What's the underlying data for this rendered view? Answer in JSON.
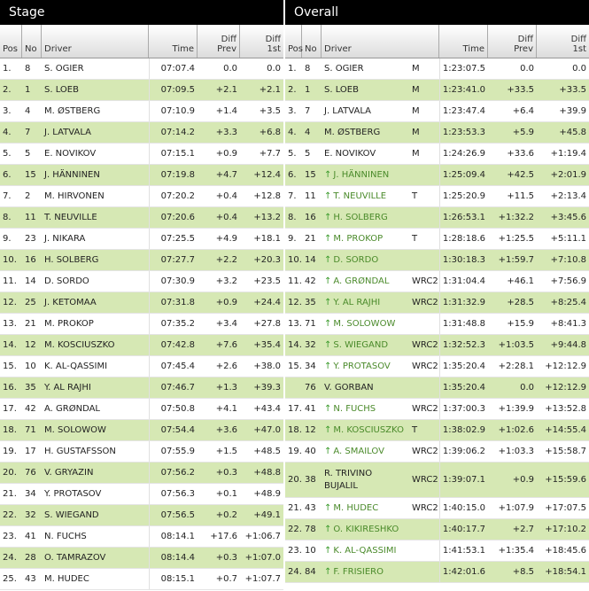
{
  "stage": {
    "title": "Stage",
    "headers": {
      "pos": "Pos",
      "no": "No",
      "driver": "Driver",
      "time": "Time",
      "diff_prev": "Diff\nPrev",
      "diff_1st": "Diff\n1st"
    },
    "rows": [
      {
        "pos": "1.",
        "no": "8",
        "driver": "S. OGIER",
        "time": "07:07.4",
        "dp": "0.0",
        "d1": "0.0"
      },
      {
        "pos": "2.",
        "no": "1",
        "driver": "S. LOEB",
        "time": "07:09.5",
        "dp": "+2.1",
        "d1": "+2.1"
      },
      {
        "pos": "3.",
        "no": "4",
        "driver": "M. ØSTBERG",
        "time": "07:10.9",
        "dp": "+1.4",
        "d1": "+3.5"
      },
      {
        "pos": "4.",
        "no": "7",
        "driver": "J. LATVALA",
        "time": "07:14.2",
        "dp": "+3.3",
        "d1": "+6.8"
      },
      {
        "pos": "5.",
        "no": "5",
        "driver": "E. NOVIKOV",
        "time": "07:15.1",
        "dp": "+0.9",
        "d1": "+7.7"
      },
      {
        "pos": "6.",
        "no": "15",
        "driver": "J. HÄNNINEN",
        "time": "07:19.8",
        "dp": "+4.7",
        "d1": "+12.4"
      },
      {
        "pos": "7.",
        "no": "2",
        "driver": "M. HIRVONEN",
        "time": "07:20.2",
        "dp": "+0.4",
        "d1": "+12.8"
      },
      {
        "pos": "8.",
        "no": "11",
        "driver": "T. NEUVILLE",
        "time": "07:20.6",
        "dp": "+0.4",
        "d1": "+13.2"
      },
      {
        "pos": "9.",
        "no": "23",
        "driver": "J. NIKARA",
        "time": "07:25.5",
        "dp": "+4.9",
        "d1": "+18.1"
      },
      {
        "pos": "10.",
        "no": "16",
        "driver": "H. SOLBERG",
        "time": "07:27.7",
        "dp": "+2.2",
        "d1": "+20.3"
      },
      {
        "pos": "11.",
        "no": "14",
        "driver": "D. SORDO",
        "time": "07:30.9",
        "dp": "+3.2",
        "d1": "+23.5"
      },
      {
        "pos": "12.",
        "no": "25",
        "driver": "J. KETOMAA",
        "time": "07:31.8",
        "dp": "+0.9",
        "d1": "+24.4"
      },
      {
        "pos": "13.",
        "no": "21",
        "driver": "M. PROKOP",
        "time": "07:35.2",
        "dp": "+3.4",
        "d1": "+27.8"
      },
      {
        "pos": "14.",
        "no": "12",
        "driver": "M. KOSCIUSZKO",
        "time": "07:42.8",
        "dp": "+7.6",
        "d1": "+35.4"
      },
      {
        "pos": "15.",
        "no": "10",
        "driver": "K. AL-QASSIMI",
        "time": "07:45.4",
        "dp": "+2.6",
        "d1": "+38.0"
      },
      {
        "pos": "16.",
        "no": "35",
        "driver": "Y. AL RAJHI",
        "time": "07:46.7",
        "dp": "+1.3",
        "d1": "+39.3"
      },
      {
        "pos": "17.",
        "no": "42",
        "driver": "A. GRØNDAL",
        "time": "07:50.8",
        "dp": "+4.1",
        "d1": "+43.4"
      },
      {
        "pos": "18.",
        "no": "71",
        "driver": "M. SOLOWOW",
        "time": "07:54.4",
        "dp": "+3.6",
        "d1": "+47.0"
      },
      {
        "pos": "19.",
        "no": "17",
        "driver": "H. GUSTAFSSON",
        "time": "07:55.9",
        "dp": "+1.5",
        "d1": "+48.5"
      },
      {
        "pos": "20.",
        "no": "76",
        "driver": "V. GRYAZIN",
        "time": "07:56.2",
        "dp": "+0.3",
        "d1": "+48.8"
      },
      {
        "pos": "21.",
        "no": "34",
        "driver": "Y. PROTASOV",
        "time": "07:56.3",
        "dp": "+0.1",
        "d1": "+48.9"
      },
      {
        "pos": "22.",
        "no": "32",
        "driver": "S. WIEGAND",
        "time": "07:56.5",
        "dp": "+0.2",
        "d1": "+49.1"
      },
      {
        "pos": "23.",
        "no": "41",
        "driver": "N. FUCHS",
        "time": "08:14.1",
        "dp": "+17.6",
        "d1": "+1:06.7"
      },
      {
        "pos": "24.",
        "no": "28",
        "driver": "O. TAMRAZOV",
        "time": "08:14.4",
        "dp": "+0.3",
        "d1": "+1:07.0"
      },
      {
        "pos": "25.",
        "no": "43",
        "driver": "M. HUDEC",
        "time": "08:15.1",
        "dp": "+0.7",
        "d1": "+1:07.7"
      }
    ]
  },
  "overall": {
    "title": "Overall",
    "headers": {
      "pos": "Pos",
      "no": "No",
      "driver": "Driver",
      "time": "Time",
      "diff_prev": "Diff\nPrev",
      "diff_1st": "Diff\n1st"
    },
    "rows": [
      {
        "pos": "1.",
        "no": "8",
        "up": false,
        "driver": "S. OGIER",
        "cls": "M",
        "time": "1:23:07.5",
        "dp": "0.0",
        "d1": "0.0"
      },
      {
        "pos": "2.",
        "no": "1",
        "up": false,
        "driver": "S. LOEB",
        "cls": "M",
        "time": "1:23:41.0",
        "dp": "+33.5",
        "d1": "+33.5"
      },
      {
        "pos": "3.",
        "no": "7",
        "up": false,
        "driver": "J. LATVALA",
        "cls": "M",
        "time": "1:23:47.4",
        "dp": "+6.4",
        "d1": "+39.9"
      },
      {
        "pos": "4.",
        "no": "4",
        "up": false,
        "driver": "M. ØSTBERG",
        "cls": "M",
        "time": "1:23:53.3",
        "dp": "+5.9",
        "d1": "+45.8"
      },
      {
        "pos": "5.",
        "no": "5",
        "up": false,
        "driver": "E. NOVIKOV",
        "cls": "M",
        "time": "1:24:26.9",
        "dp": "+33.6",
        "d1": "+1:19.4"
      },
      {
        "pos": "6.",
        "no": "15",
        "up": true,
        "driver": "J. HÄNNINEN",
        "cls": "",
        "time": "1:25:09.4",
        "dp": "+42.5",
        "d1": "+2:01.9"
      },
      {
        "pos": "7.",
        "no": "11",
        "up": true,
        "driver": "T. NEUVILLE",
        "cls": "T",
        "time": "1:25:20.9",
        "dp": "+11.5",
        "d1": "+2:13.4"
      },
      {
        "pos": "8.",
        "no": "16",
        "up": true,
        "driver": "H. SOLBERG",
        "cls": "",
        "time": "1:26:53.1",
        "dp": "+1:32.2",
        "d1": "+3:45.6"
      },
      {
        "pos": "9.",
        "no": "21",
        "up": true,
        "driver": "M. PROKOP",
        "cls": "T",
        "time": "1:28:18.6",
        "dp": "+1:25.5",
        "d1": "+5:11.1"
      },
      {
        "pos": "10.",
        "no": "14",
        "up": true,
        "driver": "D. SORDO",
        "cls": "",
        "time": "1:30:18.3",
        "dp": "+1:59.7",
        "d1": "+7:10.8"
      },
      {
        "pos": "11.",
        "no": "42",
        "up": true,
        "driver": "A. GRØNDAL",
        "cls": "WRC2",
        "time": "1:31:04.4",
        "dp": "+46.1",
        "d1": "+7:56.9"
      },
      {
        "pos": "12.",
        "no": "35",
        "up": true,
        "driver": "Y. AL RAJHI",
        "cls": "WRC2",
        "time": "1:31:32.9",
        "dp": "+28.5",
        "d1": "+8:25.4"
      },
      {
        "pos": "13.",
        "no": "71",
        "up": true,
        "driver": "M. SOLOWOW",
        "cls": "",
        "time": "1:31:48.8",
        "dp": "+15.9",
        "d1": "+8:41.3"
      },
      {
        "pos": "14.",
        "no": "32",
        "up": true,
        "driver": "S. WIEGAND",
        "cls": "WRC2",
        "time": "1:32:52.3",
        "dp": "+1:03.5",
        "d1": "+9:44.8"
      },
      {
        "pos": "15.",
        "no": "34",
        "up": true,
        "driver": "Y. PROTASOV",
        "cls": "WRC2",
        "time": "1:35:20.4",
        "dp": "+2:28.1",
        "d1": "+12:12.9"
      },
      {
        "pos": "",
        "no": "76",
        "up": false,
        "driver": "V. GORBAN",
        "cls": "",
        "time": "1:35:20.4",
        "dp": "0.0",
        "d1": "+12:12.9"
      },
      {
        "pos": "17.",
        "no": "41",
        "up": true,
        "driver": "N. FUCHS",
        "cls": "WRC2",
        "time": "1:37:00.3",
        "dp": "+1:39.9",
        "d1": "+13:52.8"
      },
      {
        "pos": "18.",
        "no": "12",
        "up": true,
        "driver": "M. KOSCIUSZKO",
        "cls": "T",
        "time": "1:38:02.9",
        "dp": "+1:02.6",
        "d1": "+14:55.4"
      },
      {
        "pos": "19.",
        "no": "40",
        "up": true,
        "driver": "A. SMAILOV",
        "cls": "WRC2",
        "time": "1:39:06.2",
        "dp": "+1:03.3",
        "d1": "+15:58.7"
      },
      {
        "pos": "20.",
        "no": "38",
        "up": false,
        "driver": "R. TRIVINO BUJALIL",
        "cls": "WRC2",
        "time": "1:39:07.1",
        "dp": "+0.9",
        "d1": "+15:59.6",
        "tall": true
      },
      {
        "pos": "21.",
        "no": "43",
        "up": true,
        "driver": "M. HUDEC",
        "cls": "WRC2",
        "time": "1:40:15.0",
        "dp": "+1:07.9",
        "d1": "+17:07.5"
      },
      {
        "pos": "22.",
        "no": "78",
        "up": true,
        "driver": "O. KIKIRESHKO",
        "cls": "",
        "time": "1:40:17.7",
        "dp": "+2.7",
        "d1": "+17:10.2"
      },
      {
        "pos": "23.",
        "no": "10",
        "up": true,
        "driver": "K. AL-QASSIMI",
        "cls": "",
        "time": "1:41:53.1",
        "dp": "+1:35.4",
        "d1": "+18:45.6"
      },
      {
        "pos": "24.",
        "no": "84",
        "up": true,
        "driver": "F. FRISIERO",
        "cls": "",
        "time": "1:42:01.6",
        "dp": "+8.5",
        "d1": "+18:54.1"
      }
    ]
  },
  "colors": {
    "alt_row": "#d6e8b4",
    "header_bar": "#000000",
    "up_arrow": "#3a9a2a"
  }
}
